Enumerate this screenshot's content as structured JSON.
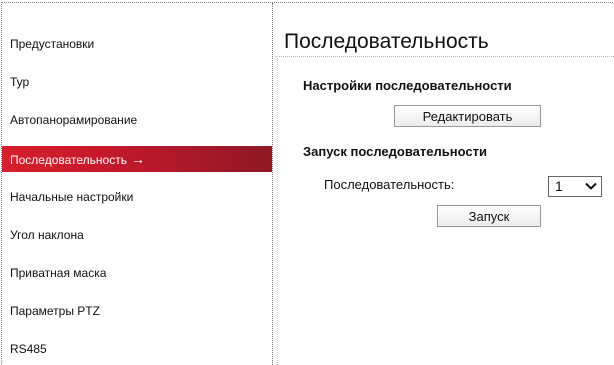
{
  "sidebar": {
    "items": [
      {
        "label": "Предустановки"
      },
      {
        "label": "Тур"
      },
      {
        "label": "Автопанорамирование"
      },
      {
        "label": "Последовательность",
        "active": true
      },
      {
        "label": "Начальные настройки"
      },
      {
        "label": "Угол наклона"
      },
      {
        "label": "Приватная маска"
      },
      {
        "label": "Параметры PTZ"
      },
      {
        "label": "RS485"
      }
    ],
    "active_arrow": "→"
  },
  "main": {
    "title": "Последовательность",
    "settings_heading": "Настройки последовательности",
    "edit_button": "Редактировать",
    "run_heading": "Запуск последовательности",
    "sequence_label": "Последовательность:",
    "sequence_select": {
      "value": "1"
    },
    "run_button": "Запуск"
  },
  "colors": {
    "active_item": "#c81d2b"
  }
}
